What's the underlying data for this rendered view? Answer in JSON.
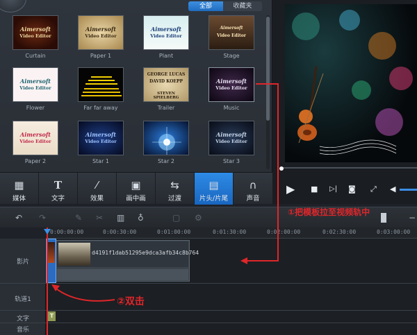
{
  "library": {
    "segments": {
      "all": "全部",
      "favorites": "收藏夹"
    },
    "templates": [
      {
        "label": "Curtain",
        "title": "Aimersoft",
        "subtitle": "Video Editor"
      },
      {
        "label": "Paper 1",
        "title": "Aimersoft",
        "subtitle": "Video Editor"
      },
      {
        "label": "Plant",
        "title": "Aimersoft",
        "subtitle": "Video Editor"
      },
      {
        "label": "Stage",
        "title": "Aimersoft",
        "subtitle": "Video Editor"
      },
      {
        "label": "Flower",
        "title": "Aimersoft",
        "subtitle": "Video Editor"
      },
      {
        "label": "Far far away",
        "title": "",
        "subtitle": ""
      },
      {
        "label": "Trailer",
        "title": "GEORGE LUCAS",
        "subtitle": "DAVID KOEPP",
        "extra": "STEVEN SPIELBERG"
      },
      {
        "label": "Music",
        "title": "Aimersoft",
        "subtitle": "Video Editor"
      },
      {
        "label": "Paper 2",
        "title": "Aimersoft",
        "subtitle": "Video Editor"
      },
      {
        "label": "Star 1",
        "title": "Aimersoft",
        "subtitle": "Video Editor"
      },
      {
        "label": "Star 2",
        "title": "",
        "subtitle": ""
      },
      {
        "label": "Star 3",
        "title": "Aimersoft",
        "subtitle": "Video Editor"
      }
    ]
  },
  "tabs": [
    {
      "label": "媒体",
      "icon": "film-icon"
    },
    {
      "label": "文字",
      "icon": "text-icon"
    },
    {
      "label": "效果",
      "icon": "magic-wand-icon"
    },
    {
      "label": "画中画",
      "icon": "picture-in-picture-icon"
    },
    {
      "label": "过渡",
      "icon": "transition-icon"
    },
    {
      "label": "片头/片尾",
      "icon": "clapperboard-icon",
      "active": true
    },
    {
      "label": "声音",
      "icon": "headphones-icon"
    }
  ],
  "timeline": {
    "ruler": [
      "0:00:00:00",
      "0:00:30:00",
      "0:01:00:00",
      "0:01:30:00",
      "0:02:00:00",
      "0:02:30:00",
      "0:03:00:00"
    ],
    "tracks": {
      "video": "影片",
      "track1": "轨道1",
      "text": "文字",
      "music": "音乐"
    },
    "clip_name": "d4191f1dab51295e9dca3afb34c8b764",
    "text_clip_glyph": "T"
  },
  "annotations": {
    "drag": "①把模板拉至视频轨中",
    "double_click": "②双击"
  },
  "colors": {
    "accent": "#1f6cc0",
    "annotation": "#e0262a"
  }
}
